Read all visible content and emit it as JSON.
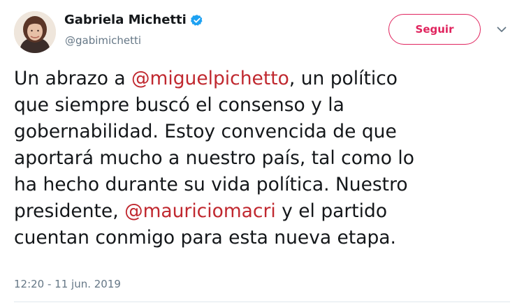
{
  "author": {
    "display_name": "Gabriela Michetti",
    "handle": "@gabimichetti",
    "verified": true
  },
  "follow_button": {
    "label": "Seguir"
  },
  "tweet": {
    "lines": [
      {
        "parts": [
          {
            "type": "text",
            "value": "Un abrazo a "
          },
          {
            "type": "mention",
            "value": "@miguelpichetto"
          },
          {
            "type": "text",
            "value": ", un político"
          }
        ]
      },
      {
        "parts": [
          {
            "type": "text",
            "value": "que siempre buscó el consenso y la"
          }
        ]
      },
      {
        "parts": [
          {
            "type": "text",
            "value": "gobernabilidad. Estoy convencida de que"
          }
        ]
      },
      {
        "parts": [
          {
            "type": "text",
            "value": "aportará mucho a nuestro país, tal como lo"
          }
        ]
      },
      {
        "parts": [
          {
            "type": "text",
            "value": "ha hecho durante su vida política. Nuestro"
          }
        ]
      },
      {
        "parts": [
          {
            "type": "text",
            "value": "presidente, "
          },
          {
            "type": "mention",
            "value": "@mauriciomacri"
          },
          {
            "type": "text",
            "value": " y el partido"
          }
        ]
      },
      {
        "parts": [
          {
            "type": "text",
            "value": "cuentan conmigo para esta nueva etapa."
          }
        ]
      }
    ],
    "timestamp": "12:20 - 11 jun. 2019"
  },
  "icons": {
    "verified": "verified-badge-icon",
    "caret": "chevron-down-icon"
  },
  "colors": {
    "mention": "#c0282f",
    "follow_border": "#e0245e",
    "verified_blue": "#1da1f2",
    "secondary_text": "#657786"
  }
}
